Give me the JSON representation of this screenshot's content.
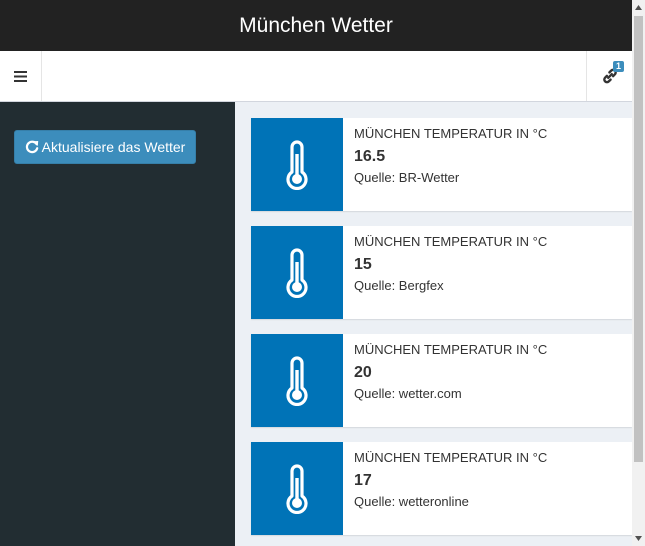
{
  "header": {
    "title": "München Wetter"
  },
  "navbar": {
    "link_badge": "1"
  },
  "sidebar": {
    "refresh_label": "Aktualisiere das Wetter"
  },
  "colors": {
    "accent": "#3c8dbc",
    "icon_bg": "#0073b7",
    "sidebar_bg": "#222d32",
    "titlebar_bg": "#222222"
  },
  "cards": [
    {
      "title": "MÜNCHEN TEMPERATUR IN °C",
      "value": "16.5",
      "source": "Quelle: BR-Wetter",
      "icon": "thermometer-icon"
    },
    {
      "title": "MÜNCHEN TEMPERATUR IN °C",
      "value": "15",
      "source": "Quelle: Bergfex",
      "icon": "thermometer-icon"
    },
    {
      "title": "MÜNCHEN TEMPERATUR IN °C",
      "value": "20",
      "source": "Quelle: wetter.com",
      "icon": "thermometer-icon"
    },
    {
      "title": "MÜNCHEN TEMPERATUR IN °C",
      "value": "17",
      "source": "Quelle: wetteronline",
      "icon": "thermometer-icon"
    }
  ]
}
